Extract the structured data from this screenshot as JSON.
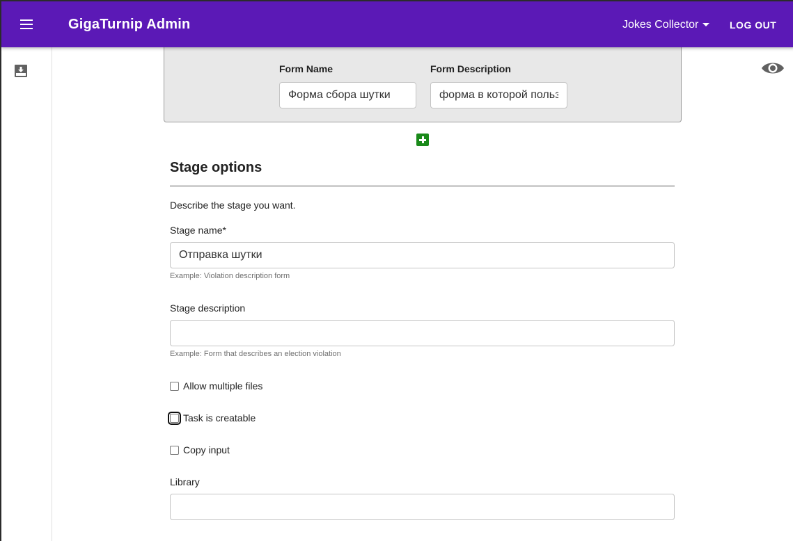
{
  "theme": {
    "brand": "#5b19b6",
    "add": "#1a8a1a"
  },
  "header": {
    "menu_icon": "menu-icon",
    "title": "GigaTurnip Admin",
    "campaign": "Jokes Collector",
    "campaign_icon": "caret-down-icon",
    "logout_label": "LOG OUT"
  },
  "sidebar": {
    "items": [
      {
        "icon": "inbox-download-icon"
      }
    ]
  },
  "preview": {
    "icon": "eye-icon"
  },
  "form_card": {
    "name_label": "Form Name",
    "name_value": "Форма сбора шутки",
    "description_label": "Form Description",
    "description_value": "форма в которой пользователь отправляет шутку"
  },
  "add_button": {
    "icon": "plus-square-icon"
  },
  "stage_options": {
    "title": "Stage options",
    "description": "Describe the stage you want.",
    "name_label": "Stage name*",
    "name_value": "Отправка шутки",
    "name_help": "Example: Violation description form",
    "description_label": "Stage description",
    "description_value": "",
    "description_help": "Example: Form that describes an election violation",
    "checkboxes": [
      {
        "label": "Allow multiple files",
        "checked": false
      },
      {
        "label": "Task is creatable",
        "checked": false
      },
      {
        "label": "Copy input",
        "checked": false
      }
    ],
    "library_label": "Library",
    "library_value": ""
  }
}
